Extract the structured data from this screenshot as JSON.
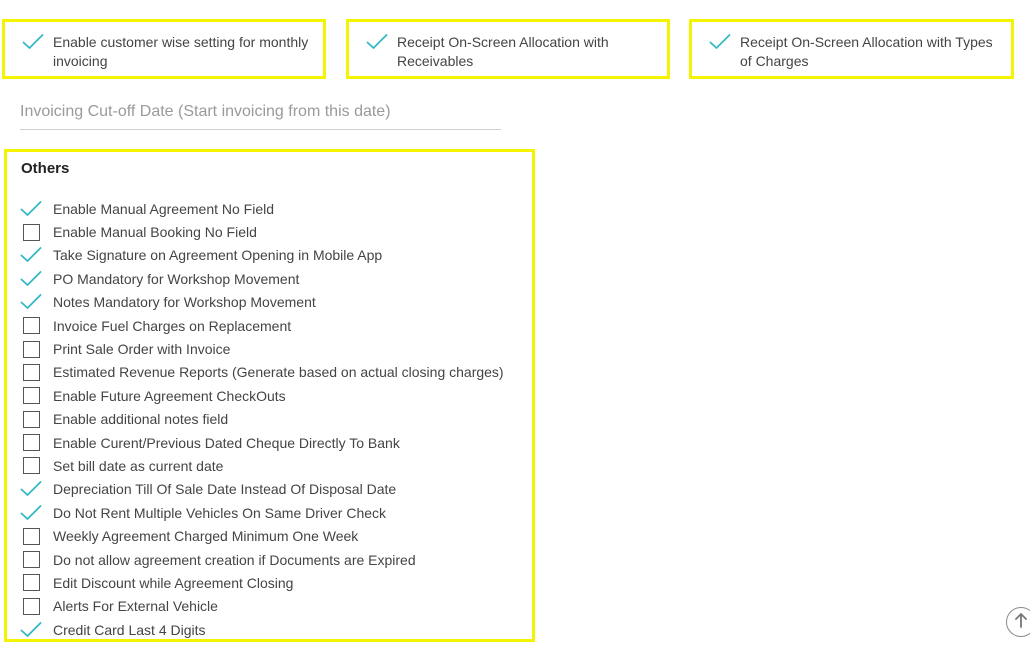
{
  "top_options": [
    {
      "label": "Enable customer wise setting for monthly invoicing",
      "checked": true
    },
    {
      "label": "Receipt On-Screen Allocation with Receivables",
      "checked": true
    },
    {
      "label": "Receipt On-Screen Allocation with Types of Charges",
      "checked": true
    }
  ],
  "cutoff": {
    "placeholder": "Invoicing Cut-off Date (Start invoicing from this date)",
    "value": ""
  },
  "others": {
    "title": "Others",
    "items": [
      {
        "label": "Enable Manual Agreement No Field",
        "checked": true
      },
      {
        "label": "Enable Manual Booking No Field",
        "checked": false
      },
      {
        "label": "Take Signature on Agreement Opening in Mobile App",
        "checked": true
      },
      {
        "label": "PO Mandatory for Workshop Movement",
        "checked": true
      },
      {
        "label": "Notes Mandatory for Workshop Movement",
        "checked": true
      },
      {
        "label": "Invoice Fuel Charges on Replacement",
        "checked": false
      },
      {
        "label": "Print Sale Order with Invoice",
        "checked": false
      },
      {
        "label": "Estimated Revenue Reports (Generate based on actual closing charges)",
        "checked": false
      },
      {
        "label": "Enable Future Agreement CheckOuts",
        "checked": false
      },
      {
        "label": "Enable additional notes field",
        "checked": false
      },
      {
        "label": "Enable Curent/Previous Dated Cheque Directly To Bank",
        "checked": false
      },
      {
        "label": "Set bill date as current date",
        "checked": false
      },
      {
        "label": "Depreciation Till Of Sale Date Instead Of Disposal Date",
        "checked": true
      },
      {
        "label": "Do Not Rent Multiple Vehicles On Same Driver Check",
        "checked": true
      },
      {
        "label": "Weekly Agreement Charged Minimum One Week",
        "checked": false
      },
      {
        "label": "Do not allow agreement creation if Documents are Expired",
        "checked": false
      },
      {
        "label": "Edit Discount while Agreement Closing",
        "checked": false
      },
      {
        "label": "Alerts For External Vehicle",
        "checked": false
      },
      {
        "label": "Credit Card Last 4 Digits",
        "checked": true
      }
    ]
  },
  "colors": {
    "check": "#35b9c4",
    "highlight": "#f4f400",
    "text": "#444444"
  },
  "icons": {
    "checked": "check-icon",
    "unchecked": "checkbox-empty-icon",
    "scroll_top": "arrow-up-circle-icon"
  }
}
